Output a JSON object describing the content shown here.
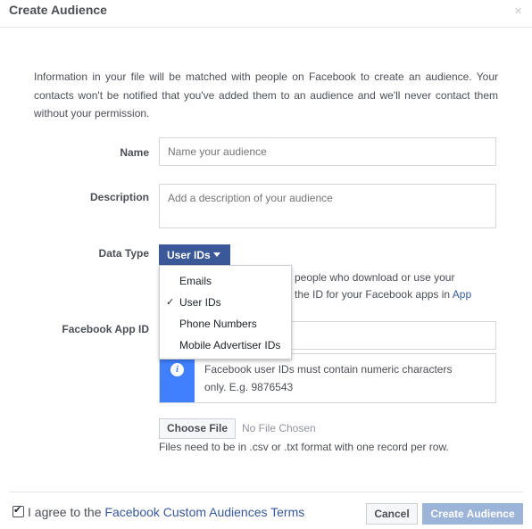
{
  "dialog": {
    "title": "Create Audience",
    "close_glyph": "×",
    "intro": "Information in your file will be matched with people on Facebook to create an audience. Your contacts won't be notified that you've added them to an audience and we'll never contact them without your permission."
  },
  "form": {
    "name_label": "Name",
    "name_placeholder": "Name your audience",
    "description_label": "Description",
    "description_placeholder": "Add a description of your audience",
    "data_type_label": "Data Type",
    "data_type_value": "User IDs",
    "data_type_desc_1": "people who download or use your",
    "data_type_desc_2": "the ID for your Facebook apps in",
    "data_type_desc_link": "App",
    "app_id_label": "Facebook App ID",
    "app_id_value": "",
    "info_text": "Facebook user IDs must contain numeric characters only. E.g. 9876543",
    "choose_file_label": "Choose File",
    "no_file_text": "No File Chosen",
    "file_hint": "Files need to be in .csv or .txt format with one record per row."
  },
  "dropdown": {
    "options": [
      {
        "label": "Emails",
        "checked": false
      },
      {
        "label": "User IDs",
        "checked": true
      },
      {
        "label": "Phone Numbers",
        "checked": false
      },
      {
        "label": "Mobile Advertiser IDs",
        "checked": false
      }
    ],
    "check_glyph": "✓"
  },
  "footer": {
    "agree_prefix": "I agree to the",
    "agree_link": "Facebook Custom Audiences Terms",
    "agreed": true,
    "cancel_label": "Cancel",
    "create_label": "Create Audience"
  },
  "colors": {
    "brand": "#3b5998",
    "link": "#365899",
    "info": "#4080ff",
    "disabled_button": "#9cb4d8"
  }
}
